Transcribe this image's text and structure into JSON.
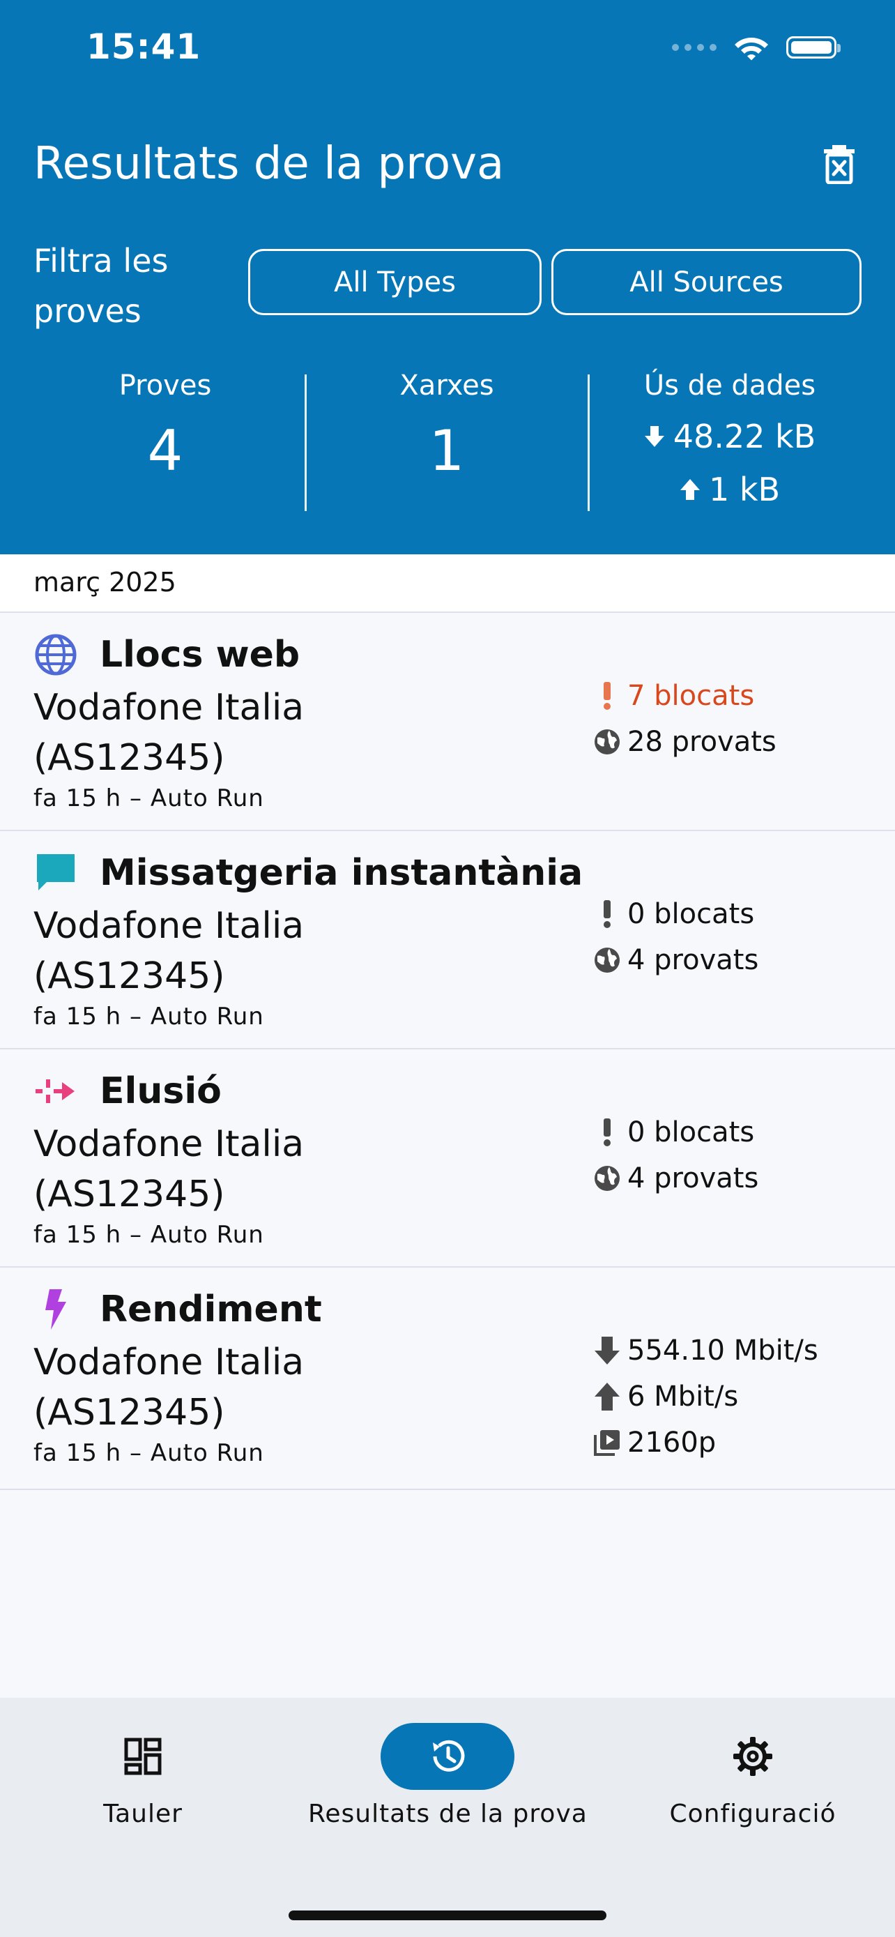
{
  "status_bar": {
    "time": "15:41"
  },
  "header": {
    "title": "Resultats de la prova",
    "filter_label": "Filtra les proves",
    "filter_types": "All Types",
    "filter_sources": "All Sources",
    "stats": {
      "tests_label": "Proves",
      "tests_value": "4",
      "networks_label": "Xarxes",
      "networks_value": "1",
      "data_label": "Ús de dades",
      "download": "48.22 kB",
      "upload": "1 kB"
    }
  },
  "month": "març 2025",
  "tests": [
    {
      "title": "Llocs web",
      "icon": "globe-icon",
      "icon_color": "#4f6ad6",
      "network": "Vodafone Italia (AS12345)",
      "meta": "fa 15 h – Auto Run",
      "blocked": "7 blocats",
      "blocked_color": "#d9481c",
      "tested": "28 provats"
    },
    {
      "title": "Missatgeria instantània",
      "icon": "chat-icon",
      "icon_color": "#1ba8bd",
      "network": "Vodafone Italia (AS12345)",
      "meta": "fa 15 h – Auto Run",
      "blocked": "0 blocats",
      "tested": "4 provats"
    },
    {
      "title": "Elusió",
      "icon": "circumvention-icon",
      "icon_color": "#e8407f",
      "network": "Vodafone Italia (AS12345)",
      "meta": "fa 15 h – Auto Run",
      "blocked": "0 blocats",
      "tested": "4 provats"
    },
    {
      "title": "Rendiment",
      "icon": "lightning-icon",
      "icon_color": "#b140e0",
      "network": "Vodafone Italia (AS12345)",
      "meta": "fa 15 h – Auto Run",
      "download": "554.10 Mbit/s",
      "upload": "6 Mbit/s",
      "video": "2160p"
    }
  ],
  "bottom_nav": {
    "dashboard": "Tauler",
    "results": "Resultats de la prova",
    "settings": "Configuració"
  },
  "colors": {
    "primary": "#0676b6",
    "background": "#f6f8fc",
    "nav_background": "#e9edf1"
  }
}
